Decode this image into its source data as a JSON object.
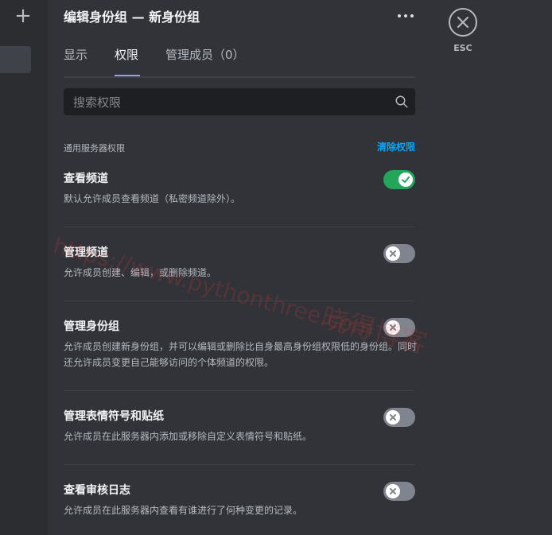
{
  "header": {
    "title": "编辑身份组 — 新身份组",
    "more_icon": "more-horizontal-icon"
  },
  "tabs": [
    {
      "label": "显示",
      "active": false
    },
    {
      "label": "权限",
      "active": true
    },
    {
      "label": "管理成员（0）",
      "active": false
    }
  ],
  "search": {
    "placeholder": "搜索权限",
    "value": "",
    "icon": "search-icon"
  },
  "section": {
    "title": "通用服务器权限",
    "clear_label": "清除权限"
  },
  "permissions": [
    {
      "name": "查看频道",
      "description": "默认允许成员查看频道（私密频道除外）。",
      "enabled": true
    },
    {
      "name": "管理频道",
      "description": "允许成员创建、编辑，或删除频道。",
      "enabled": false
    },
    {
      "name": "管理身份组",
      "description": "允许成员创建新身份组，并可以编辑或删除比自身最高身份组权限低的身份组。同时还允许成员变更自己能够访问的个体频道的权限。",
      "enabled": false
    },
    {
      "name": "管理表情符号和贴纸",
      "description": "允许成员在此服务器内添加或移除自定义表情符号和贴纸。",
      "enabled": false
    },
    {
      "name": "查看审核日志",
      "description": "允许成员在此服务器内查看有谁进行了何种变更的记录。",
      "enabled": false
    }
  ],
  "close": {
    "label": "ESC",
    "icon": "close-icon"
  },
  "rail": {
    "add_icon": "plus-icon"
  },
  "watermark": {
    "line1": "https://www.pythonthree.com",
    "line2": "晓得博客"
  },
  "colors": {
    "background": "#313338",
    "toggle_on": "#23a55a",
    "toggle_off": "#80848e",
    "link": "#00a8fc",
    "tab_underline": "#949cf7"
  }
}
